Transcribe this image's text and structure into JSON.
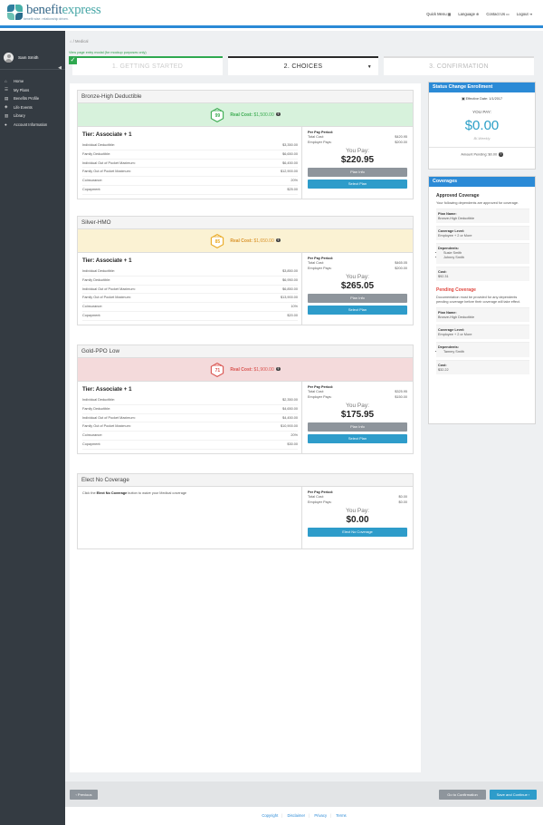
{
  "brand": {
    "name_part1": "benefit",
    "name_part2": "express",
    "tagline": "benefit wise. relationship driven."
  },
  "topnav": [
    {
      "label": "Quick Menu",
      "icon": "grid-icon"
    },
    {
      "label": "Language",
      "icon": "globe-icon"
    },
    {
      "label": "Contact Us",
      "icon": "chat-icon"
    },
    {
      "label": "Logout",
      "icon": "logout-icon"
    }
  ],
  "sidebar": {
    "user_name": "Sam Smith",
    "items": [
      {
        "label": "Home",
        "icon": "home-icon"
      },
      {
        "label": "My Plans",
        "icon": "list-icon"
      },
      {
        "label": "Benefits Profile",
        "icon": "profile-icon"
      },
      {
        "label": "Life Events",
        "icon": "event-icon"
      },
      {
        "label": "Library",
        "icon": "book-icon"
      },
      {
        "label": "Account Information",
        "icon": "user-icon"
      }
    ]
  },
  "breadcrumb": {
    "home_icon": "home-icon",
    "current": "Medical"
  },
  "modal_link": "View page entry modal (for mockup purposes only)",
  "steps": [
    "1. GETTING STARTED",
    "2. CHOICES",
    "3. CONFIRMATION"
  ],
  "plans": [
    {
      "name": "Bronze-High Deductible",
      "score_label": "SCORE",
      "score": "99",
      "real_cost_label": "Real Cost:",
      "real_cost": "$1,500.00",
      "tier": "Tier: Associate + 1",
      "details": [
        {
          "k": "Individual Deductible:",
          "v": "$3,350.00"
        },
        {
          "k": "Family Deductible:",
          "v": "$6,650.00"
        },
        {
          "k": "Individual Out of Pocket Maximum:",
          "v": "$6,450.00"
        },
        {
          "k": "Family Out of Pocket Maximum:",
          "v": "$12,900.00"
        },
        {
          "k": "Coinsurance:",
          "v": "20%"
        },
        {
          "k": "Copayment:",
          "v": "$25.00"
        }
      ],
      "per_pay_title": "Per Pay Period:",
      "total_cost_label": "Total Cost:",
      "total_cost": "$420.95",
      "employer_pays_label": "Employer Pays:",
      "employer_pays": "$200.00",
      "you_pay_label": "You Pay:",
      "you_pay": "$220.95",
      "plan_info": "Plan Info",
      "select": "Select Plan"
    },
    {
      "name": "Silver-HMO",
      "score_label": "SCORE",
      "score": "85",
      "real_cost_label": "Real Cost:",
      "real_cost": "$1,650.00",
      "tier": "Tier: Associate + 1",
      "details": [
        {
          "k": "Individual Deductible:",
          "v": "$3,850.00"
        },
        {
          "k": "Family Deductible:",
          "v": "$6,950.00"
        },
        {
          "k": "Individual Out of Pocket Maximum:",
          "v": "$6,850.00"
        },
        {
          "k": "Family Out of Pocket Maximum:",
          "v": "$13,900.00"
        },
        {
          "k": "Coinsurance:",
          "v": "10%"
        },
        {
          "k": "Copayment:",
          "v": "$20.00"
        }
      ],
      "per_pay_title": "Per Pay Period:",
      "total_cost_label": "Total Cost:",
      "total_cost": "$465.05",
      "employer_pays_label": "Employer Pays:",
      "employer_pays": "$200.00",
      "you_pay_label": "You Pay:",
      "you_pay": "$265.05",
      "plan_info": "Plan Info",
      "select": "Select Plan"
    },
    {
      "name": "Gold-PPO Low",
      "score_label": "SCORE",
      "score": "71",
      "real_cost_label": "Real Cost:",
      "real_cost": "$1,900.00",
      "tier": "Tier: Associate + 1",
      "details": [
        {
          "k": "Individual Deductible:",
          "v": "$2,350.00"
        },
        {
          "k": "Family Deductible:",
          "v": "$4,650.00"
        },
        {
          "k": "Individual Out of Pocket Maximum:",
          "v": "$4,450.00"
        },
        {
          "k": "Family Out of Pocket Maximum:",
          "v": "$10,900.00"
        },
        {
          "k": "Coinsurance:",
          "v": "20%"
        },
        {
          "k": "Copayment:",
          "v": "$30.00"
        }
      ],
      "per_pay_title": "Per Pay Period:",
      "total_cost_label": "Total Cost:",
      "total_cost": "$325.95",
      "employer_pays_label": "Employer Pays:",
      "employer_pays": "$150.00",
      "you_pay_label": "You Pay:",
      "you_pay": "$175.95",
      "plan_info": "Plan Info",
      "select": "Select Plan"
    }
  ],
  "no_coverage": {
    "title": "Elect No Coverage",
    "text_pre": "Click the ",
    "text_bold": "Elect No Coverage",
    "text_post": " button to waive your Medical coverage",
    "per_pay_title": "Per Pay Period:",
    "total_cost_label": "Total Cost:",
    "total_cost": "$0.00",
    "employer_pays_label": "Employer Pays:",
    "employer_pays": "$0.00",
    "you_pay_label": "You Pay:",
    "you_pay": "$0.00",
    "button": "Elect No Coverage"
  },
  "status_panel": {
    "title": "Status Change Enrollment",
    "effective_date": "Effective Date: 1/1/2017",
    "you_pay_label": "YOU PAY:",
    "amount": "$0.00",
    "frequency": "Bi-Weekly",
    "amount_pending": "Amount Pending: $0.00"
  },
  "coverages_panel": {
    "title": "Coverages",
    "approved_title": "Approved Coverage",
    "approved_text": "Your following dependents are approved for coverage.",
    "approved": {
      "plan_name_label": "Plan Name:",
      "plan_name": "Bronze-High Deductible",
      "level_label": "Coverage Level:",
      "level": "Employee + 2 or More",
      "dependents_label": "Dependents:",
      "dependents": [
        "Susie Smith",
        "Johnny Smith"
      ],
      "cost_label": "Cost:",
      "cost": "$92.31"
    },
    "pending_title": "Pending Coverage",
    "pending_text": "Documentation must be provided for any dependents pending coverage before their coverage will take effect.",
    "pending": {
      "plan_name_label": "Plan Name:",
      "plan_name": "Bronze-High Deductible",
      "level_label": "Coverage Level:",
      "level": "Employee + 2 or More",
      "dependents_label": "Dependents:",
      "dependents": [
        "Tammy Smith"
      ],
      "cost_label": "Cost:",
      "cost": "$32.22"
    }
  },
  "bottom": {
    "previous": "‹ Previous",
    "go_confirm": "Go to Confirmation",
    "save_continue": "Save and Continue ›"
  },
  "footer": [
    "Copyright",
    "Disclaimer",
    "Privacy",
    "Terms"
  ],
  "colors": {
    "accent": "#2b8ad6",
    "green_band": "#d7f2dc",
    "yellow_band": "#fbf2d3",
    "red_band": "#f4dadb",
    "green": "#3bab50",
    "yellow": "#e9a923",
    "red": "#d9534f"
  }
}
